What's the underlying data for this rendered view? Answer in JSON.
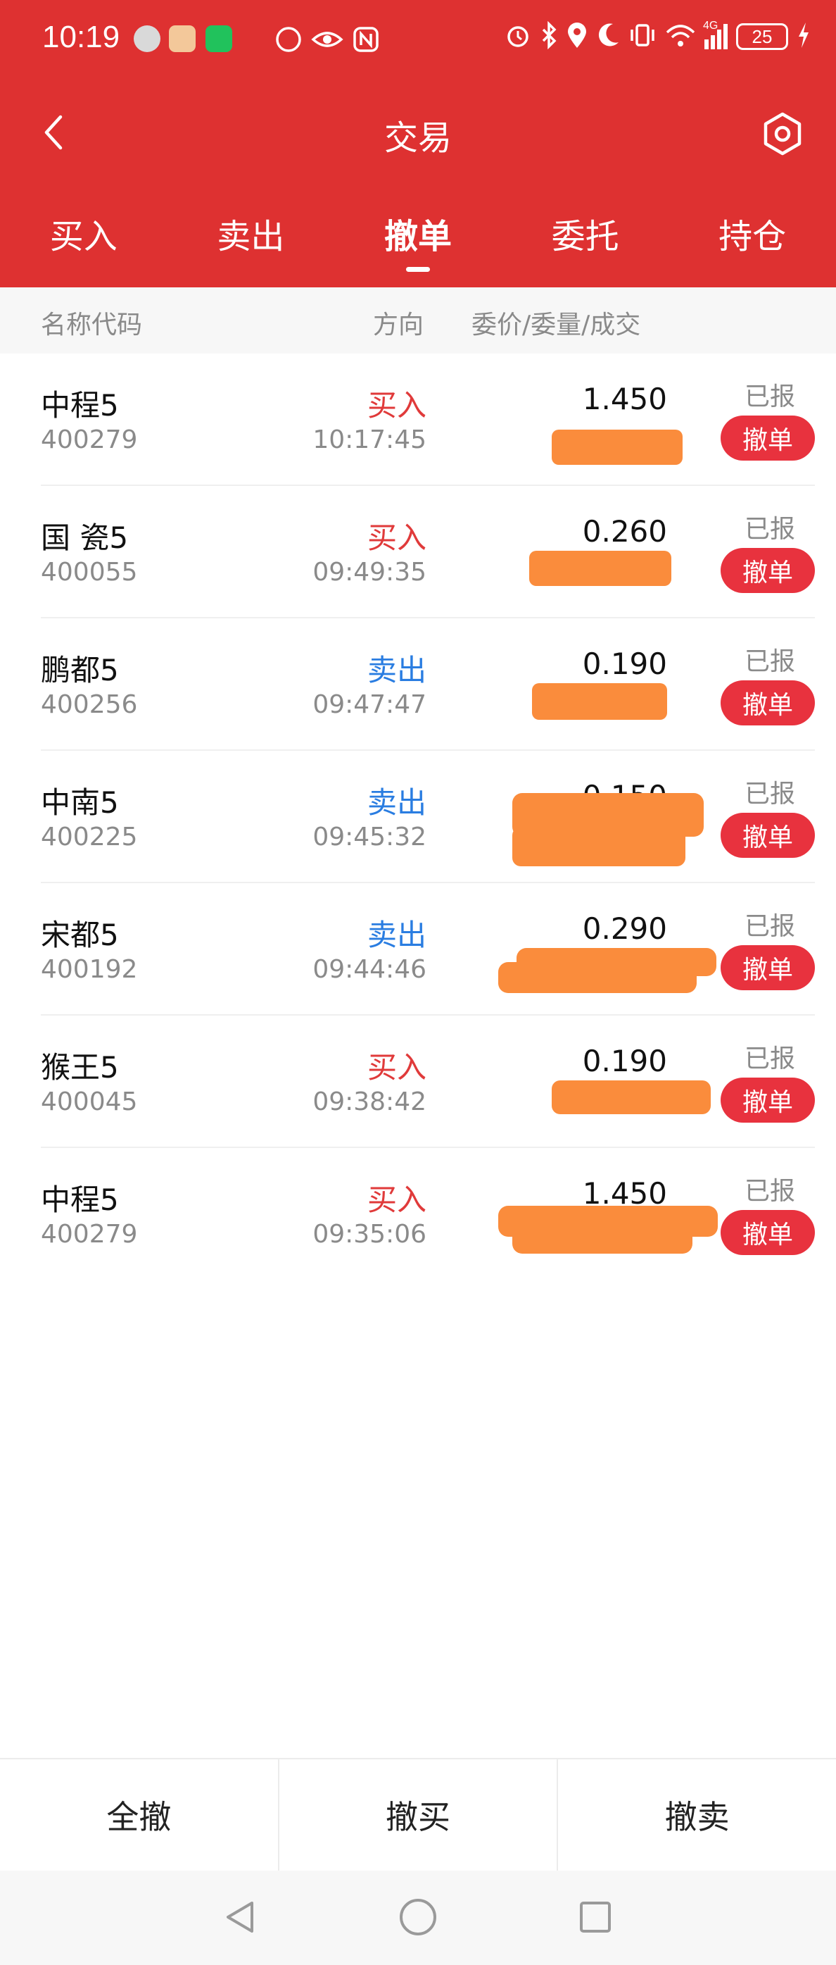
{
  "status_bar": {
    "time": "10:19",
    "network": "4G",
    "battery": "25",
    "icons": [
      "alarm-icon",
      "bluetooth-icon",
      "location-icon",
      "moon-icon",
      "vibrate-icon",
      "wifi-icon",
      "signal-icon",
      "charging-icon"
    ]
  },
  "navbar": {
    "title": "交易"
  },
  "tabs": [
    {
      "label": "买入"
    },
    {
      "label": "卖出"
    },
    {
      "label": "撤单"
    },
    {
      "label": "委托"
    },
    {
      "label": "持仓"
    }
  ],
  "active_tab": "撤单",
  "columns": {
    "name_code": "名称代码",
    "direction": "方向",
    "price_qty": "委价/委量/成交"
  },
  "orders": [
    {
      "name": "中程5",
      "code": "400279",
      "direction": "买入",
      "time": "10:17:45",
      "price": "1.450",
      "status": "已报",
      "action": "撤单"
    },
    {
      "name": "国 瓷5",
      "code": "400055",
      "direction": "买入",
      "time": "09:49:35",
      "price": "0.260",
      "status": "已报",
      "action": "撤单"
    },
    {
      "name": "鹏都5",
      "code": "400256",
      "direction": "卖出",
      "time": "09:47:47",
      "price": "0.190",
      "status": "已报",
      "action": "撤单"
    },
    {
      "name": "中南5",
      "code": "400225",
      "direction": "卖出",
      "time": "09:45:32",
      "price": "0.150",
      "status": "已报",
      "action": "撤单"
    },
    {
      "name": "宋都5",
      "code": "400192",
      "direction": "卖出",
      "time": "09:44:46",
      "price": "0.290",
      "status": "已报",
      "action": "撤单"
    },
    {
      "name": "猴王5",
      "code": "400045",
      "direction": "买入",
      "time": "09:38:42",
      "price": "0.190",
      "status": "已报",
      "action": "撤单"
    },
    {
      "name": "中程5",
      "code": "400279",
      "direction": "买入",
      "time": "09:35:06",
      "price": "1.450",
      "status": "已报",
      "action": "撤单"
    }
  ],
  "bottom_actions": [
    {
      "label": "全撤"
    },
    {
      "label": "撤买"
    },
    {
      "label": "撤卖"
    }
  ],
  "colors": {
    "brand_red": "#de3131",
    "buy": "#e03a3a",
    "sell": "#2a7de1",
    "cancel_button": "#e8323e",
    "redaction": "#fa8c3c"
  }
}
